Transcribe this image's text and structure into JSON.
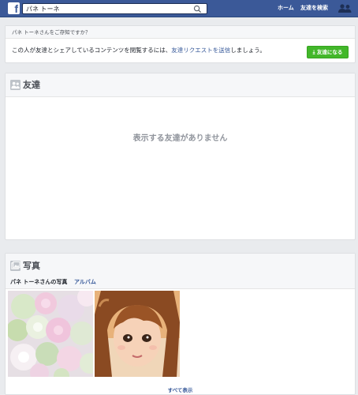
{
  "topbar": {
    "logo": "f",
    "search_value": "パネ トーネ",
    "nav_home": "ホーム",
    "nav_find_friends": "友達を検索"
  },
  "know": {
    "heading": "パネ トーネさんをご存知ですか？",
    "body_prefix": "この人が友達とシェアしているコンテンツを閲覧するには、",
    "body_link": "友達リクエストを送信",
    "body_suffix": "しましょう。",
    "add_friend_label": "友達になる"
  },
  "friends": {
    "title": "友達",
    "empty_message": "表示する友達がありません"
  },
  "photos": {
    "title": "写真",
    "tab_user_photos": "パネ トーネさんの写真",
    "tab_albums": "アルバム",
    "see_all": "すべて表示"
  },
  "colors": {
    "brand": "#3b5998",
    "add_friend_green": "#42b72a",
    "link": "#365899"
  }
}
